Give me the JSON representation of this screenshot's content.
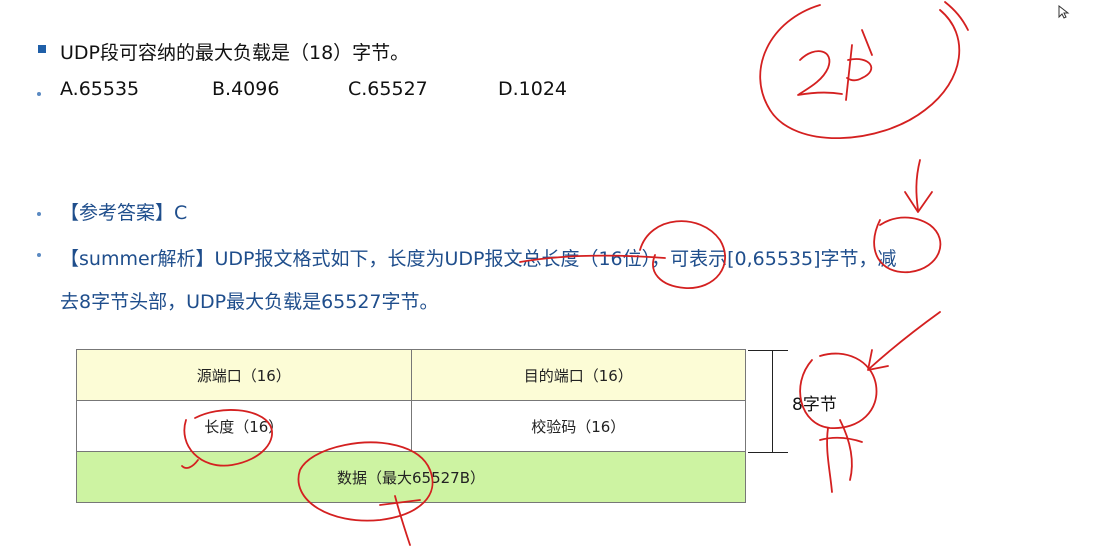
{
  "question": {
    "text": "UDP段可容纳的最大负载是（18）字节。",
    "options": [
      "A.65535",
      "B.4096",
      "C.65527",
      "D.1024"
    ]
  },
  "answer": {
    "text": "【参考答案】C"
  },
  "analysis": {
    "line1": "【summer解析】UDP报文格式如下，长度为UDP报文总长度（16位），可表示[0,65535]字节，减",
    "line2": "去8字节头部，UDP最大负载是65527字节。"
  },
  "table": {
    "row1": [
      "源端口（16）",
      "目的端口（16）"
    ],
    "row2": [
      "长度（16）",
      "校验码（16）"
    ],
    "row3": "数据（最大65527B）"
  },
  "header_size_label": "8字节",
  "colors": {
    "header_fill": "#fcfcd6",
    "data_fill": "#cdf3a2",
    "annotation_ink": "#d42020",
    "text_blue": "#1f4e8c"
  },
  "icons": [
    "mouse-cursor-icon",
    "square-bullet-icon",
    "dot-bullet-icon"
  ]
}
